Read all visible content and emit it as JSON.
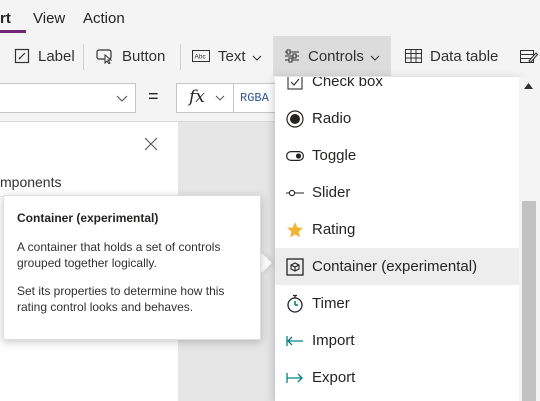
{
  "menu": {
    "insert": "rt",
    "view": "View",
    "action": "Action"
  },
  "ribbon": {
    "label": "Label",
    "button": "Button",
    "text": "Text",
    "controls": "Controls",
    "data_table": "Data table"
  },
  "formula": {
    "equals": "=",
    "fx": "fx",
    "value": "RGBA"
  },
  "left_pane": {
    "components_label": "mponents"
  },
  "tooltip": {
    "title": "Container (experimental)",
    "desc1": "A container that holds a set of controls grouped together logically.",
    "desc2": "Set its properties to determine how this rating control looks and behaves."
  },
  "dropdown": {
    "items": [
      {
        "label": "Check box",
        "icon": "checkbox-icon"
      },
      {
        "label": "Radio",
        "icon": "radio-icon"
      },
      {
        "label": "Toggle",
        "icon": "toggle-icon"
      },
      {
        "label": "Slider",
        "icon": "slider-icon"
      },
      {
        "label": "Rating",
        "icon": "star-icon"
      },
      {
        "label": "Container (experimental)",
        "icon": "container-icon",
        "selected": true
      },
      {
        "label": "Timer",
        "icon": "timer-icon"
      },
      {
        "label": "Import",
        "icon": "import-icon"
      },
      {
        "label": "Export",
        "icon": "export-icon"
      }
    ]
  },
  "colors": {
    "accent": "#742774",
    "rating_star": "#f2b233",
    "teal": "#038387",
    "selection": "#ededed"
  }
}
